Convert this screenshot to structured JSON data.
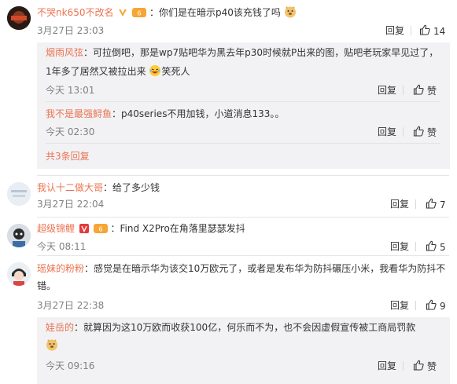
{
  "comments": [
    {
      "username": "不哭nk650不改名",
      "text": "：你们是在暗示p40该充钱了吗",
      "time": "3月27日 23:03",
      "reply_label": "回复",
      "likes": "14",
      "replies": [
        {
          "username": "烟雨风弦",
          "text": "：可拉倒吧，那是wp7贴吧华为黑去年p30时候就P出来的图，贴吧老玩家早见过了，",
          "text2": "1年多了居然又被拉出来",
          "text3": "笑死人",
          "time": "今天 13:01",
          "reply_label": "回复",
          "like_label": "赞"
        },
        {
          "username": "我不是最强鲟鱼",
          "text": "：p40series不用加钱，小道消息133。。",
          "time": "今天 02:30",
          "reply_label": "回复",
          "like_label": "赞"
        }
      ],
      "more_replies": "共3条回复"
    },
    {
      "username": "我认十二做大哥",
      "text": "：给了多少钱",
      "time": "3月27日 22:04",
      "reply_label": "回复",
      "likes": "7"
    },
    {
      "username": "超级锦鲤",
      "text": "：Find X2Pro在角落里瑟瑟发抖",
      "time": "今天 08:11",
      "reply_label": "回复",
      "likes": "5"
    },
    {
      "username": "瑶妹的粉粉",
      "text": "：感觉是在暗示华为该交10万欧元了，或者是发布华为防抖碾压小米，我看华为防抖不",
      "text2": "错。",
      "time": "3月27日 22:38",
      "reply_label": "回复",
      "likes": "9",
      "replies": [
        {
          "username": "娃岳的",
          "text": "：就算因为这10万欧而收获100亿，何乐而不为，也不会因虚假宣传被工商局罚款",
          "time": "今天 09:16",
          "reply_label": "回复",
          "like_label": "赞"
        }
      ]
    }
  ],
  "colors": {
    "username": "#eb7350",
    "meta": "#808080",
    "reply_bg": "#f2f2f5",
    "vip_badge": "#f7a535"
  }
}
